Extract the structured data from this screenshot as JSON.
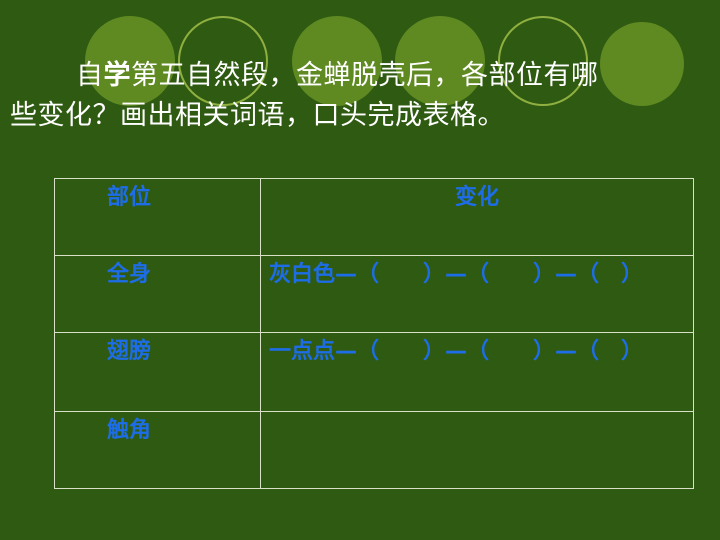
{
  "title": {
    "line1_a": "自",
    "line1_b": "学",
    "line1_c": "第五自然段，金蝉脱壳后，各部位有哪",
    "line2": "些变化？画出相关词语，口头完成表格。"
  },
  "table": {
    "headers": [
      "部位",
      "变化"
    ],
    "rows": [
      {
        "part": "全身",
        "change": "灰白色—（　　）—（　　）—（　）"
      },
      {
        "part": "翅膀",
        "change": "一点点—（　　）—（　　）—（　）"
      },
      {
        "part": "触角",
        "change": ""
      }
    ]
  },
  "colors": {
    "background": "#2f5a12",
    "text": "#ffffff",
    "table_text": "#1e6de8",
    "circle_fill": "#5f8a22",
    "circle_ring": "#8fb040"
  }
}
